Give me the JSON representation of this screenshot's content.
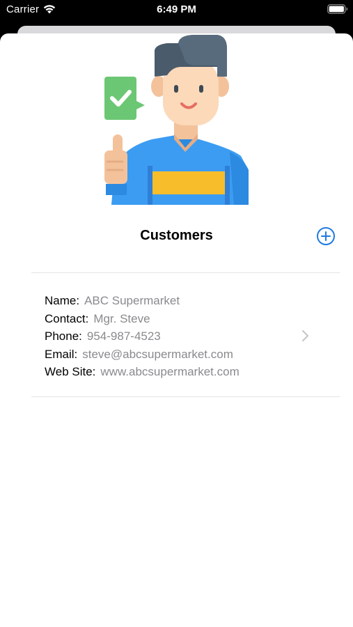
{
  "status_bar": {
    "carrier": "Carrier",
    "time": "6:49 PM"
  },
  "header": {
    "title": "Customers",
    "add_icon": "plus-circle-icon"
  },
  "customer": {
    "name_label": "Name:",
    "name": "ABC Supermarket",
    "contact_label": "Contact:",
    "contact": "Mgr. Steve",
    "phone_label": "Phone:",
    "phone": "954-987-4523",
    "email_label": "Email:",
    "email": "steve@abcsupermarket.com",
    "website_label": "Web Site:",
    "website": "www.abcsupermarket.com"
  },
  "colors": {
    "accent": "#1e7be0",
    "secondary_text": "#8a8a8e",
    "divider": "#e3e3e6"
  }
}
